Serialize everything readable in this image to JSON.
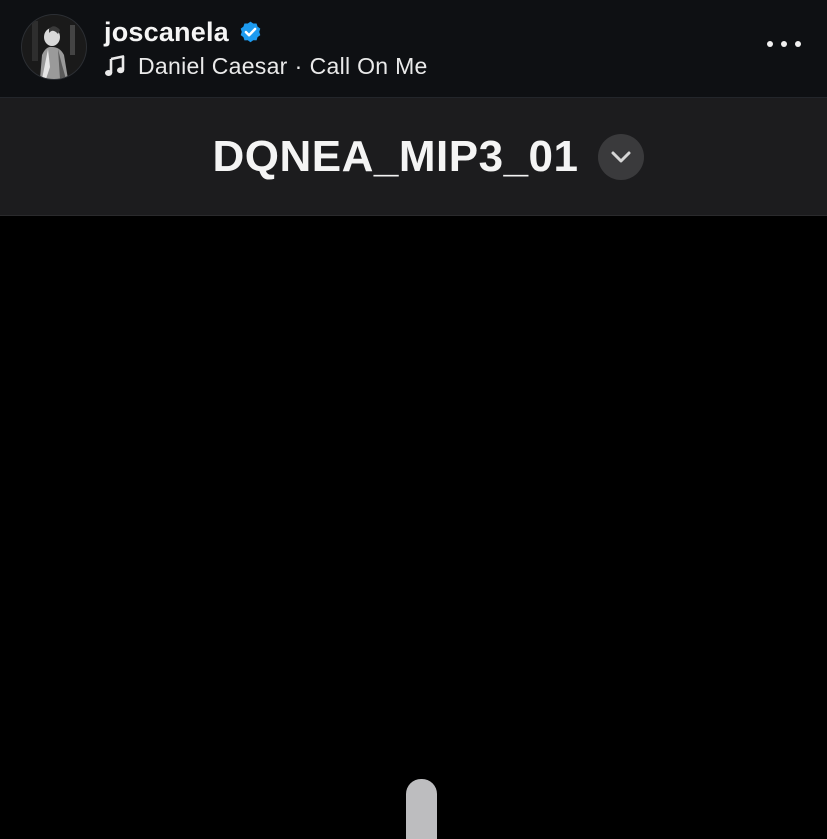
{
  "post_header": {
    "username": "joscanela",
    "verified": true,
    "audio": {
      "artist": "Daniel Caesar",
      "separator": "·",
      "song": "Call On Me"
    },
    "icons": {
      "avatar": "profile-photo",
      "verified": "verified-badge-icon",
      "music": "music-note-icon",
      "more": "more-options-icon"
    },
    "colors": {
      "background": "#0e1013",
      "verified_badge": "#1d9bf0"
    }
  },
  "app_bar": {
    "title": "DQNEA_MIP3_01",
    "dropdown_icon": "chevron-down-icon",
    "colors": {
      "background": "#1c1c1e",
      "button": "#3a3a3c"
    }
  },
  "content": {
    "background": "#000000",
    "handle_color": "#bdbdbf"
  }
}
